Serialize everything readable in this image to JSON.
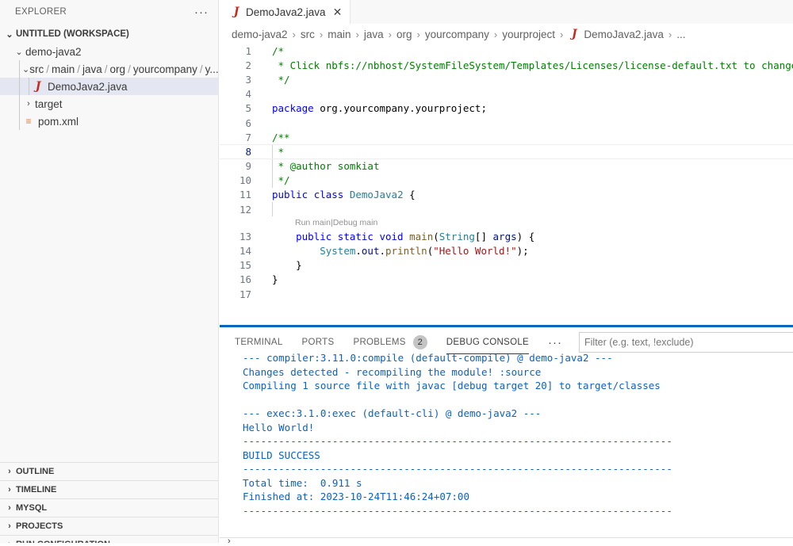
{
  "explorer": {
    "title": "EXPLORER",
    "more": "···",
    "workspace": "UNTITLED (WORKSPACE)",
    "tree": [
      {
        "label": "demo-java2",
        "indent": 1,
        "chevron": "⌄",
        "icon": ""
      },
      {
        "label": "src",
        "path": [
          "src",
          "main",
          "java",
          "org",
          "yourcompany",
          "y..."
        ],
        "indent": 2,
        "chevron": "⌄"
      },
      {
        "label": "DemoJava2.java",
        "indent": 3,
        "icon": "java",
        "selected": true
      },
      {
        "label": "target",
        "indent": 2,
        "chevron": "›"
      },
      {
        "label": "pom.xml",
        "indent": 2,
        "icon": "rss"
      }
    ],
    "sections": [
      "OUTLINE",
      "TIMELINE",
      "MYSQL",
      "PROJECTS",
      "RUN CONFIGURATION"
    ]
  },
  "tab": {
    "label": "DemoJava2.java",
    "icon": "J",
    "close": "✕"
  },
  "breadcrumb": [
    "demo-java2",
    "src",
    "main",
    "java",
    "org",
    "yourcompany",
    "yourproject",
    "DemoJava2.java",
    "..."
  ],
  "code": {
    "current_line": 8,
    "codelens": {
      "run": "Run main",
      "sep": " | ",
      "debug": "Debug main"
    },
    "lines": [
      {
        "n": "1",
        "t": "/*"
      },
      {
        "n": "2",
        "t": " * Click nbfs://nbhost/SystemFileSystem/Templates/Licenses/license-default.txt to change t"
      },
      {
        "n": "3",
        "t": " */"
      },
      {
        "n": "4",
        "t": ""
      },
      {
        "n": "5",
        "t": "package org.yourcompany.yourproject;"
      },
      {
        "n": "6",
        "t": ""
      },
      {
        "n": "7",
        "t": "/**"
      },
      {
        "n": "8",
        "t": " *"
      },
      {
        "n": "9",
        "t": " * @author somkiat"
      },
      {
        "n": "10",
        "t": " */"
      },
      {
        "n": "11",
        "t": "public class DemoJava2 {"
      },
      {
        "n": "12",
        "t": ""
      },
      {
        "n": "13",
        "t": "    public static void main(String[] args) {"
      },
      {
        "n": "14",
        "t": "        System.out.println(\"Hello World!\");"
      },
      {
        "n": "15",
        "t": "    }"
      },
      {
        "n": "16",
        "t": "}"
      },
      {
        "n": "17",
        "t": ""
      }
    ]
  },
  "panel": {
    "tabs": [
      {
        "label": "TERMINAL"
      },
      {
        "label": "PORTS"
      },
      {
        "label": "PROBLEMS",
        "badge": "2"
      },
      {
        "label": "DEBUG CONSOLE",
        "active": true
      }
    ],
    "more": "···",
    "filter_placeholder": "Filter (e.g. text, !exclude)",
    "console_lines": [
      "--- compiler:3.11.0:compile (default-compile) @ demo-java2 ---",
      "Changes detected - recompiling the module! :source",
      "Compiling 1 source file with javac [debug target 20] to target/classes",
      "",
      "--- exec:3.1.0:exec (default-cli) @ demo-java2 ---",
      "Hello World!",
      "------------------------------------------------------------------------",
      "BUILD SUCCESS",
      "------------------------------------------------------------------------",
      "Total time:  0.911 s",
      "Finished at: 2023-10-24T11:46:24+07:00",
      "------------------------------------------------------------------------"
    ],
    "prompt": "›"
  }
}
